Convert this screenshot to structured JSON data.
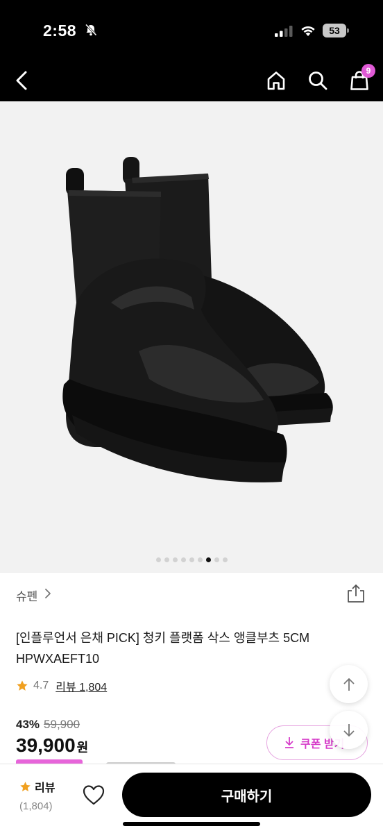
{
  "status_bar": {
    "time": "2:58",
    "battery": "53"
  },
  "nav": {
    "cart_count": "9"
  },
  "gallery": {
    "total_images": 9,
    "active_index": 7
  },
  "brand": {
    "name": "슈펜"
  },
  "product": {
    "title_line1": "[인플루언서 은채 PICK] 청키 플랫폼 삭스 앵클부츠 5CM",
    "title_line2": "HPWXAEFT10",
    "rating": "4.7",
    "review_link": "리뷰 1,804"
  },
  "pricing": {
    "discount": "43%",
    "original": "59,900",
    "price": "39,900",
    "currency": "원",
    "coupon_label": "쿠폰 받기"
  },
  "bottom_bar": {
    "review_label": "리뷰",
    "review_count": "(1,804)",
    "buy_label": "구매하기"
  },
  "colors": {
    "accent": "#d63cc9",
    "badge": "#e05ad6",
    "star": "#f0a020"
  },
  "icons": [
    "back-icon",
    "home-icon",
    "search-icon",
    "cart-icon",
    "share-icon",
    "star-icon",
    "arrow-up-icon",
    "arrow-down-icon",
    "download-icon",
    "heart-icon"
  ]
}
